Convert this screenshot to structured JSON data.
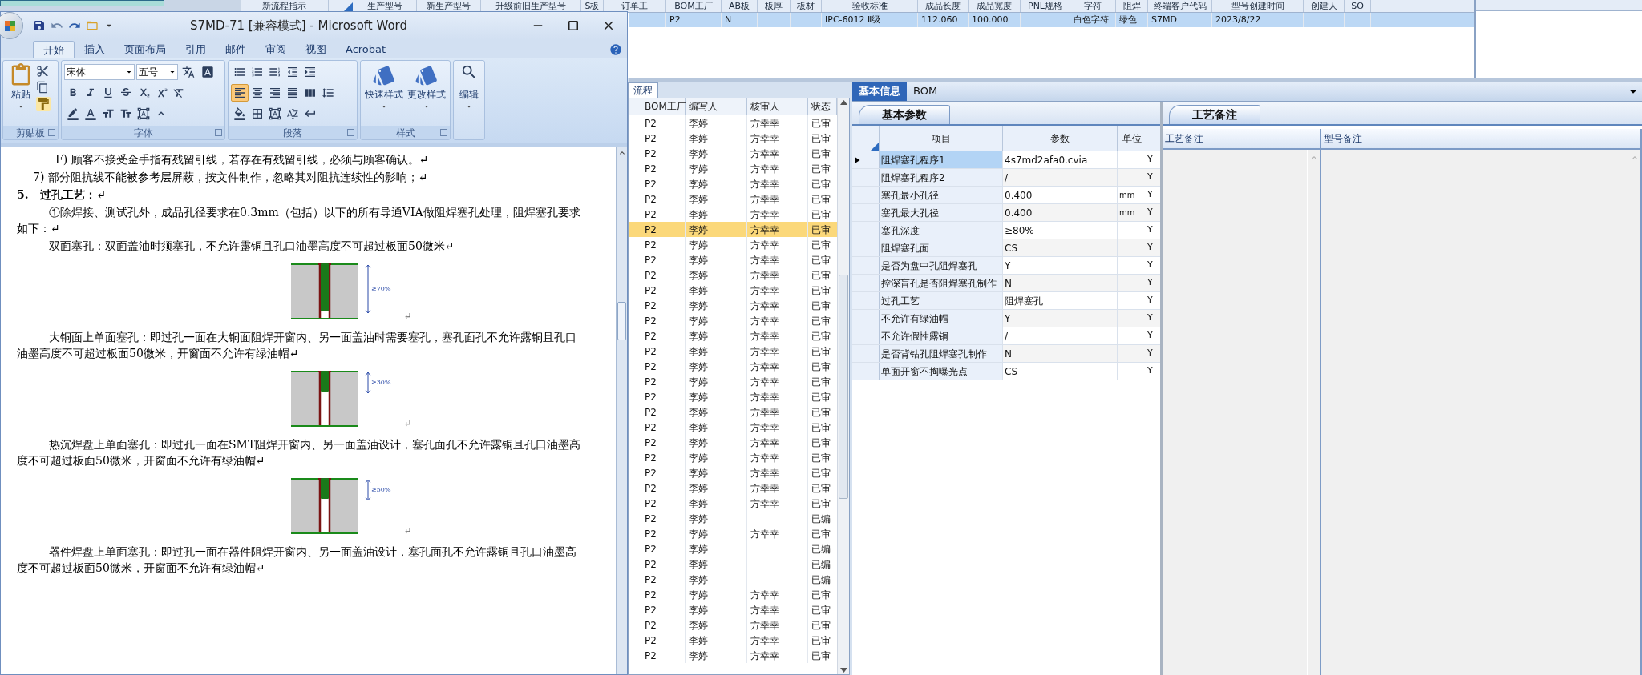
{
  "background_app": {
    "top_table": {
      "columns": [
        "新流程指示",
        "生产型号",
        "新生产型号",
        "升级前旧生产型号",
        "S板",
        "订单工",
        "BOM工厂",
        "AB板",
        "板厚",
        "板材",
        "验收标准",
        "成品长度",
        "成品宽度",
        "PNL规格",
        "字符",
        "阻焊",
        "终端客户代码",
        "型号创建时间",
        "创建人",
        "SO"
      ],
      "rows": [
        {
          "selected": true,
          "cells": [
            "",
            "",
            "",
            "",
            "",
            "",
            "P2",
            "N",
            "",
            "",
            "IPC-6012 Ⅱ级",
            "112.060",
            "100.000",
            "",
            "白色字符",
            "绿色",
            "S7MD",
            "2023/8/22",
            "",
            ""
          ]
        }
      ]
    },
    "flow_list": {
      "tab": "流程",
      "columns": [
        "BOM工厂",
        "编写人",
        "核审人",
        "状态"
      ],
      "rows": [
        {
          "bom_factory": "P2",
          "author": "李婷",
          "reviewer": "方幸幸",
          "status": "已审",
          "selected": false
        },
        {
          "bom_factory": "P2",
          "author": "李婷",
          "reviewer": "方幸幸",
          "status": "已审",
          "selected": false
        },
        {
          "bom_factory": "P2",
          "author": "李婷",
          "reviewer": "方幸幸",
          "status": "已审",
          "selected": false
        },
        {
          "bom_factory": "P2",
          "author": "李婷",
          "reviewer": "方幸幸",
          "status": "已审",
          "selected": false
        },
        {
          "bom_factory": "P2",
          "author": "李婷",
          "reviewer": "方幸幸",
          "status": "已审",
          "selected": false
        },
        {
          "bom_factory": "P2",
          "author": "李婷",
          "reviewer": "方幸幸",
          "status": "已审",
          "selected": false
        },
        {
          "bom_factory": "P2",
          "author": "李婷",
          "reviewer": "方幸幸",
          "status": "已审",
          "selected": false
        },
        {
          "bom_factory": "P2",
          "author": "李婷",
          "reviewer": "方幸幸",
          "status": "已审",
          "selected": true
        },
        {
          "bom_factory": "P2",
          "author": "李婷",
          "reviewer": "方幸幸",
          "status": "已审",
          "selected": false
        },
        {
          "bom_factory": "P2",
          "author": "李婷",
          "reviewer": "方幸幸",
          "status": "已审",
          "selected": false
        },
        {
          "bom_factory": "P2",
          "author": "李婷",
          "reviewer": "方幸幸",
          "status": "已审",
          "selected": false
        },
        {
          "bom_factory": "P2",
          "author": "李婷",
          "reviewer": "方幸幸",
          "status": "已审",
          "selected": false
        },
        {
          "bom_factory": "P2",
          "author": "李婷",
          "reviewer": "方幸幸",
          "status": "已审",
          "selected": false
        },
        {
          "bom_factory": "P2",
          "author": "李婷",
          "reviewer": "方幸幸",
          "status": "已审",
          "selected": false
        },
        {
          "bom_factory": "P2",
          "author": "李婷",
          "reviewer": "方幸幸",
          "status": "已审",
          "selected": false
        },
        {
          "bom_factory": "P2",
          "author": "李婷",
          "reviewer": "方幸幸",
          "status": "已审",
          "selected": false
        },
        {
          "bom_factory": "P2",
          "author": "李婷",
          "reviewer": "方幸幸",
          "status": "已审",
          "selected": false
        },
        {
          "bom_factory": "P2",
          "author": "李婷",
          "reviewer": "方幸幸",
          "status": "已审",
          "selected": false
        },
        {
          "bom_factory": "P2",
          "author": "李婷",
          "reviewer": "方幸幸",
          "status": "已审",
          "selected": false
        },
        {
          "bom_factory": "P2",
          "author": "李婷",
          "reviewer": "方幸幸",
          "status": "已审",
          "selected": false
        },
        {
          "bom_factory": "P2",
          "author": "李婷",
          "reviewer": "方幸幸",
          "status": "已审",
          "selected": false
        },
        {
          "bom_factory": "P2",
          "author": "李婷",
          "reviewer": "方幸幸",
          "status": "已审",
          "selected": false
        },
        {
          "bom_factory": "P2",
          "author": "李婷",
          "reviewer": "方幸幸",
          "status": "已审",
          "selected": false
        },
        {
          "bom_factory": "P2",
          "author": "李婷",
          "reviewer": "方幸幸",
          "status": "已审",
          "selected": false
        },
        {
          "bom_factory": "P2",
          "author": "李婷",
          "reviewer": "方幸幸",
          "status": "已审",
          "selected": false
        },
        {
          "bom_factory": "P2",
          "author": "李婷",
          "reviewer": "方幸幸",
          "status": "已审",
          "selected": false
        },
        {
          "bom_factory": "P2",
          "author": "李婷",
          "status": "已编",
          "selected": false
        },
        {
          "bom_factory": "P2",
          "author": "李婷",
          "reviewer": "方幸幸",
          "status": "已审",
          "selected": false
        },
        {
          "bom_factory": "P2",
          "author": "李婷",
          "status": "已编",
          "selected": false
        },
        {
          "bom_factory": "P2",
          "author": "李婷",
          "status": "已编",
          "selected": false
        },
        {
          "bom_factory": "P2",
          "author": "李婷",
          "status": "已编",
          "selected": false
        },
        {
          "bom_factory": "P2",
          "author": "李婷",
          "reviewer": "方幸幸",
          "status": "已审",
          "selected": false
        },
        {
          "bom_factory": "P2",
          "author": "李婷",
          "reviewer": "方幸幸",
          "status": "已审",
          "selected": false
        },
        {
          "bom_factory": "P2",
          "author": "李婷",
          "reviewer": "方幸幸",
          "status": "已审",
          "selected": false
        },
        {
          "bom_factory": "P2",
          "author": "李婷",
          "reviewer": "方幸幸",
          "status": "已审",
          "selected": false
        },
        {
          "bom_factory": "P2",
          "author": "李婷",
          "reviewer": "方幸幸",
          "status": "已审",
          "selected": false
        }
      ]
    },
    "detail": {
      "tabs": [
        {
          "label": "基本信息",
          "selected": true
        },
        {
          "label": "BOM",
          "selected": false
        }
      ],
      "params": {
        "tab": "基本参数",
        "columns": [
          "项目",
          "参数",
          "单位"
        ],
        "rows": [
          {
            "item": "阻焊塞孔程序1",
            "value": "4s7md2afa0.cvia",
            "column_4": "Y",
            "selected": true
          },
          {
            "item": "阻焊塞孔程序2",
            "value": "/",
            "column_4": "Y",
            "selected": false
          },
          {
            "item": "塞孔最小孔径",
            "value": "0.400",
            "unit": "mm",
            "column_4": "Y",
            "selected": false
          },
          {
            "item": "塞孔最大孔径",
            "value": "0.400",
            "unit": "mm",
            "column_4": "Y",
            "selected": false
          },
          {
            "item": "塞孔深度",
            "value": "≥80%",
            "column_4": "Y",
            "selected": false
          },
          {
            "item": "阻焊塞孔面",
            "value": "CS",
            "column_4": "Y",
            "selected": false
          },
          {
            "item": "是否为盘中孔阻焊塞孔",
            "value": "Y",
            "column_4": "Y",
            "selected": false
          },
          {
            "item": "控深盲孔是否阻焊塞孔制作",
            "value": "N",
            "column_4": "Y",
            "selected": false
          },
          {
            "item": "过孔工艺",
            "value": "阻焊塞孔",
            "column_4": "Y",
            "selected": false
          },
          {
            "item": "不允许有绿油帽",
            "value": "Y",
            "column_4": "Y",
            "selected": false
          },
          {
            "item": "不允许假性露铜",
            "value": "/",
            "column_4": "Y",
            "selected": false
          },
          {
            "item": "是否背钻孔阻焊塞孔制作",
            "value": "N",
            "column_4": "Y",
            "selected": false
          },
          {
            "item": "单面开窗不掏曝光点",
            "value": "CS",
            "column_4": "Y",
            "selected": false
          }
        ]
      },
      "remarks": {
        "tab": "工艺备注",
        "columns": [
          "工艺备注",
          "型号备注"
        ]
      }
    }
  },
  "word": {
    "title": "S7MD-71 [兼容模式] - Microsoft Word",
    "tabs": [
      {
        "label": "开始",
        "selected": true
      },
      {
        "label": "插入",
        "selected": false
      },
      {
        "label": "页面布局",
        "selected": false
      },
      {
        "label": "引用",
        "selected": false
      },
      {
        "label": "邮件",
        "selected": false
      },
      {
        "label": "审阅",
        "selected": false
      },
      {
        "label": "视图",
        "selected": false
      },
      {
        "label": "Acrobat",
        "selected": false
      }
    ],
    "ribbon": {
      "paste": "粘贴",
      "font_name": "宋体",
      "font_size": "五号",
      "align_buttons": [
        {
          "selected": true
        },
        {
          "selected": false
        },
        {
          "selected": false
        },
        {
          "selected": false
        },
        {
          "selected": false
        }
      ],
      "styles": [
        "快速样式",
        "更改样式"
      ],
      "edit": "编辑",
      "groups": [
        "剪贴板",
        "字体",
        "段落",
        "样式"
      ]
    },
    "document": [
      {
        "kind": "subitem",
        "text": "F) 顾客不接受金手指有残留引线，若存在有残留引线，必须与顾客确认。↵"
      },
      {
        "kind": "item",
        "text": "7) 部分阻抗线不能被参考层屏蔽，按文件制作，忽略其对阻抗连续性的影响；↵"
      },
      {
        "kind": "heading",
        "text": "5.   过孔工艺：↵"
      },
      {
        "kind": "body",
        "text": "①除焊接、测试孔外，成品孔径要求在0.3mm（包括）以下的所有导通VIA做阻焊塞孔处理，阻焊塞孔要求如下：↵"
      },
      {
        "kind": "body",
        "text": "双面塞孔：双面盖油时须塞孔，不允许露铜且孔口油墨高度不可超过板面50微米↵"
      },
      {
        "kind": "figure",
        "label": "≥70%",
        "mark": "↵"
      },
      {
        "kind": "body",
        "text": "大铜面上单面塞孔：即过孔一面在大铜面阻焊开窗内、另一面盖油时需要塞孔，塞孔面孔不允许露铜且孔口油墨高度不可超过板面50微米，开窗面不允许有绿油帽↵"
      },
      {
        "kind": "figure",
        "label": "≥30%",
        "mark": "↵"
      },
      {
        "kind": "body",
        "text": "热沉焊盘上单面塞孔：即过孔一面在SMT阻焊开窗内、另一面盖油设计，塞孔面孔不允许露铜且孔口油墨高度不可超过板面50微米，开窗面不允许有绿油帽↵"
      },
      {
        "kind": "figure",
        "label": "≥50%",
        "mark": "↵"
      },
      {
        "kind": "body",
        "text": "器件焊盘上单面塞孔：即过孔一面在器件阻焊开窗内、另一面盖油设计，塞孔面孔不允许露铜且孔口油墨高度不可超过板面50微米，开窗面不允许有绿油帽↵"
      }
    ]
  }
}
